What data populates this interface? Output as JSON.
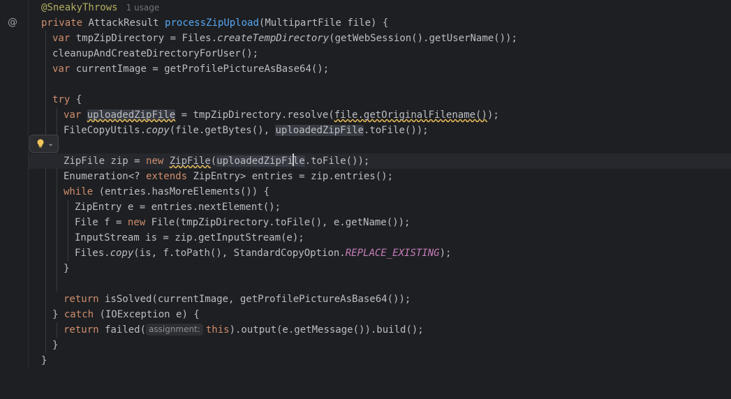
{
  "gutter": {
    "icon": "at-icon",
    "icon_glyph": "@"
  },
  "quick_fix": {
    "icon": "lightbulb-icon",
    "chevron": "⌄"
  },
  "header": {
    "annotation": "@SneakyThrows",
    "usage_hint": "1 usage"
  },
  "code": {
    "l2": {
      "private": "private",
      "type": " AttackResult ",
      "method": "processZipUpload",
      "params": "(MultipartFile file) {"
    },
    "l3": {
      "var": "var",
      "a": " tmpZipDirectory = Files.",
      "m": "createTempDirectory",
      "b": "(getWebSession().getUserName());"
    },
    "l4": {
      "a": "cleanupAndCreateDirectoryForUser();"
    },
    "l5": {
      "var": "var",
      "a": " currentImage = getProfilePictureAsBase64();"
    },
    "l7": {
      "try": "try",
      "a": " {"
    },
    "l8": {
      "var": "var",
      "sp": " ",
      "name": "uploadedZipFile",
      "a": " = tmpZipDirectory.resolve(",
      "arg": "file.getOriginalFilename()",
      "b": ");"
    },
    "l9": {
      "a": "FileCopyUtils.",
      "m": "copy",
      "b": "(file.getBytes(), ",
      "ref": "uploadedZipFile",
      "c": ".toFile());"
    },
    "l11": {
      "a": "ZipFile zip = ",
      "new": "new",
      "sp": " ",
      "cls": "ZipFile",
      "b": "(",
      "ref1": "uploadedZipFi",
      "ref2": "le",
      "c": ".toFile());"
    },
    "l12": {
      "a": "Enumeration<? ",
      "ext": "extends",
      "b": " ZipEntry> entries = zip.entries();"
    },
    "l13": {
      "while": "while",
      "a": " (entries.hasMoreElements()) {"
    },
    "l14": {
      "a": "ZipEntry e = entries.nextElement();"
    },
    "l15": {
      "a": "File f = ",
      "new": "new",
      "b": " File(tmpZipDirectory.toFile(), e.getName());"
    },
    "l16": {
      "a": "InputStream is = zip.getInputStream(e);"
    },
    "l17": {
      "a": "Files.",
      "m": "copy",
      "b": "(is, f.toPath(), StandardCopyOption.",
      "field": "REPLACE_EXISTING",
      "c": ");"
    },
    "l18": {
      "a": "}"
    },
    "l20": {
      "return": "return",
      "a": " isSolved(currentImage, getProfilePictureAsBase64());"
    },
    "l21": {
      "a": "} ",
      "catch": "catch",
      "b": " (IOException e) {"
    },
    "l22": {
      "return": "return",
      "a": " failed(",
      "hint": "assignment:",
      "this": "this",
      "b": ").output(e.getMessage()).build();"
    },
    "l23": {
      "a": "}"
    },
    "l24": {
      "a": "}"
    }
  }
}
